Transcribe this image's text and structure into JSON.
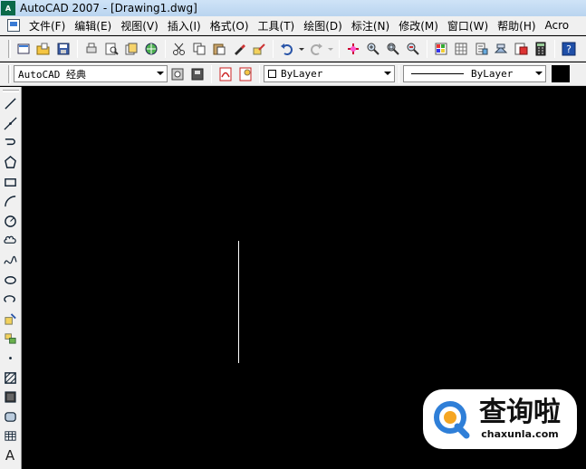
{
  "window": {
    "title": "AutoCAD 2007 - [Drawing1.dwg]",
    "app_icon_text": "A"
  },
  "menubar": {
    "items": [
      "文件(F)",
      "编辑(E)",
      "视图(V)",
      "插入(I)",
      "格式(O)",
      "工具(T)",
      "绘图(D)",
      "标注(N)",
      "修改(M)",
      "窗口(W)",
      "帮助(H)",
      "Acro"
    ]
  },
  "properties": {
    "workspace": "AutoCAD 经典",
    "color": "ByLayer",
    "linetype": "ByLayer"
  },
  "watermark": {
    "brand_cn": "查询啦",
    "brand_en": "chaxunla.com"
  },
  "colors": {
    "canvas_bg": "#000000",
    "chrome_bg": "#f0f0f0",
    "watermark_accent": "#2f7fd8"
  },
  "icons": {
    "toolbar": [
      "new-icon",
      "open-icon",
      "save-icon",
      "plot-icon",
      "plot-preview-icon",
      "publish-icon",
      "web-icon",
      "cut-icon",
      "copy-icon",
      "paste-icon",
      "match-properties-icon",
      "block-editor-icon",
      "undo-icon",
      "redo-icon",
      "pan-icon",
      "zoom-realtime-icon",
      "zoom-window-icon",
      "zoom-previous-icon",
      "properties-icon",
      "design-center-icon",
      "tool-palettes-icon",
      "sheet-set-icon",
      "markup-icon",
      "calculator-icon",
      "help-icon"
    ],
    "draw_tools": [
      "line-icon",
      "construction-line-icon",
      "polyline-icon",
      "polygon-icon",
      "rectangle-icon",
      "arc-icon",
      "circle-icon",
      "revision-cloud-icon",
      "spline-icon",
      "ellipse-icon",
      "ellipse-arc-icon",
      "insert-block-icon",
      "make-block-icon",
      "point-icon",
      "hatch-icon",
      "gradient-icon",
      "region-icon",
      "table-icon",
      "multiline-text-icon"
    ]
  },
  "draw_tools": {
    "text_tool_label": "A"
  }
}
